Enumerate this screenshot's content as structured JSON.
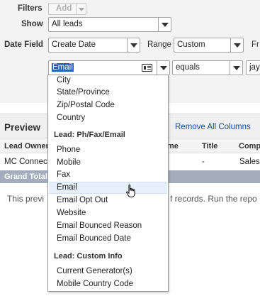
{
  "filters": {
    "label": "Filters",
    "add_button": "Add",
    "show_label": "Show",
    "show_value": "All leads",
    "date_field_label": "Date Field",
    "date_field_value": "Create Date",
    "range_label": "Range",
    "range_value": "Custom",
    "from_label_partial": "Fr"
  },
  "filter_row": {
    "field_value": "Email",
    "operator_value": "equals",
    "value_partial": "jay."
  },
  "dropdown": {
    "items_top": [
      "City",
      "State/Province",
      "Zip/Postal Code",
      "Country"
    ],
    "group_phone": "Lead: Ph/Fax/Email",
    "items_phone": [
      "Phone",
      "Mobile",
      "Fax",
      "Email",
      "Email Opt Out",
      "Website",
      "Email Bounced Reason",
      "Email Bounced Date"
    ],
    "group_custom": "Lead: Custom Info",
    "items_custom": [
      "Current Generator(s)",
      "Mobile Country Code"
    ],
    "hovered_item": "Email"
  },
  "preview": {
    "title": "Preview",
    "remove_all": "Remove All Columns",
    "columns": [
      "Lead Owner",
      "me",
      "Title",
      "Comp"
    ],
    "row": [
      "MC Connect",
      "-",
      "Sales"
    ],
    "grand_total": "Grand Total",
    "note_left": "This previ",
    "note_right": "f records. Run the repo"
  }
}
